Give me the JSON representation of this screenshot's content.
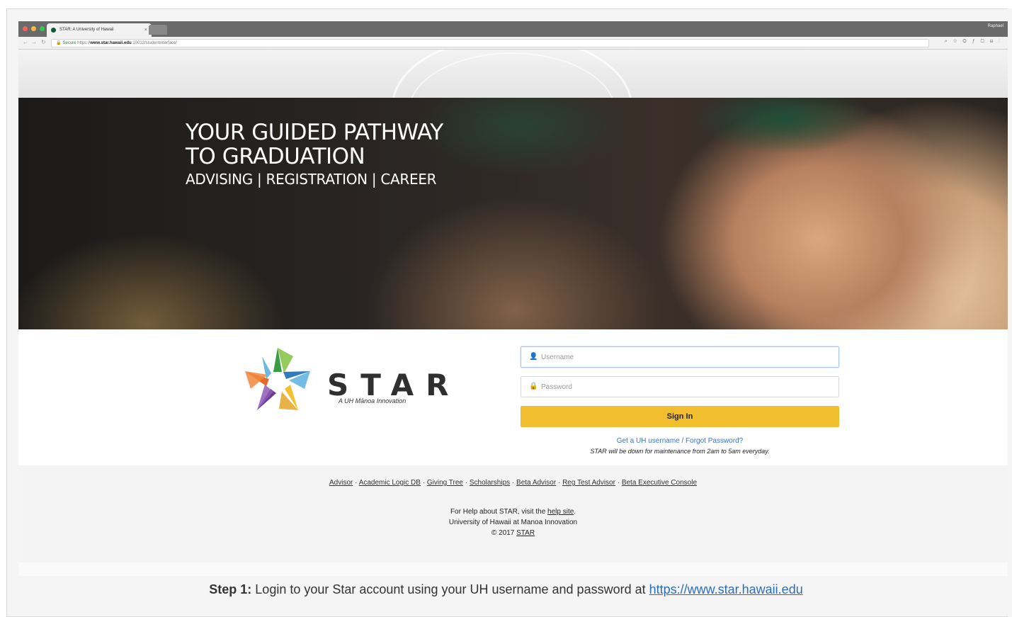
{
  "browser": {
    "tab_title": "STAR: A University of Hawaii",
    "tab_close": "×",
    "profile": "Raphael",
    "url_secure": "Secure",
    "url_scheme": "https://",
    "url_host": "www.star.hawaii.edu",
    "url_path": ":10012/studentinterface/",
    "window_dot_colors": [
      "#fc605c",
      "#fdbc40",
      "#34c84a"
    ]
  },
  "hero": {
    "line1": "YOUR GUIDED PATHWAY",
    "line2": "TO GRADUATION",
    "line3": "ADVISING | REGISTRATION | CAREER"
  },
  "logo": {
    "word": "STAR",
    "subtitle": "A UH Mānoa Innovation"
  },
  "login": {
    "username_placeholder": "Username",
    "password_placeholder": "Password",
    "signin_label": "Sign In",
    "forgot_text": "Get a UH username / Forgot Password?",
    "maintenance_text": "STAR will be down for maintenance from 2am to 5am everyday."
  },
  "footer": {
    "links": [
      "Advisor",
      "Academic Logic DB",
      "Giving Tree",
      "Scholarships",
      "Beta Advisor",
      "Reg Test Advisor",
      "Beta Executive Console"
    ],
    "separator": " · ",
    "help_prefix": "For Help about STAR, visit the ",
    "help_link": "help site",
    "help_suffix": ".",
    "university_line": "University of Hawaii at Manoa Innovation",
    "copyright_prefix": "© 2017 ",
    "copyright_link": "STAR"
  },
  "caption": {
    "step_label": "Step 1:",
    "text": " Login to your Star account using your UH username and password at ",
    "link": "https://www.star.hawaii.edu"
  },
  "colors": {
    "accent_signin": "#f1be30",
    "link_blue": "#3a73c8"
  }
}
